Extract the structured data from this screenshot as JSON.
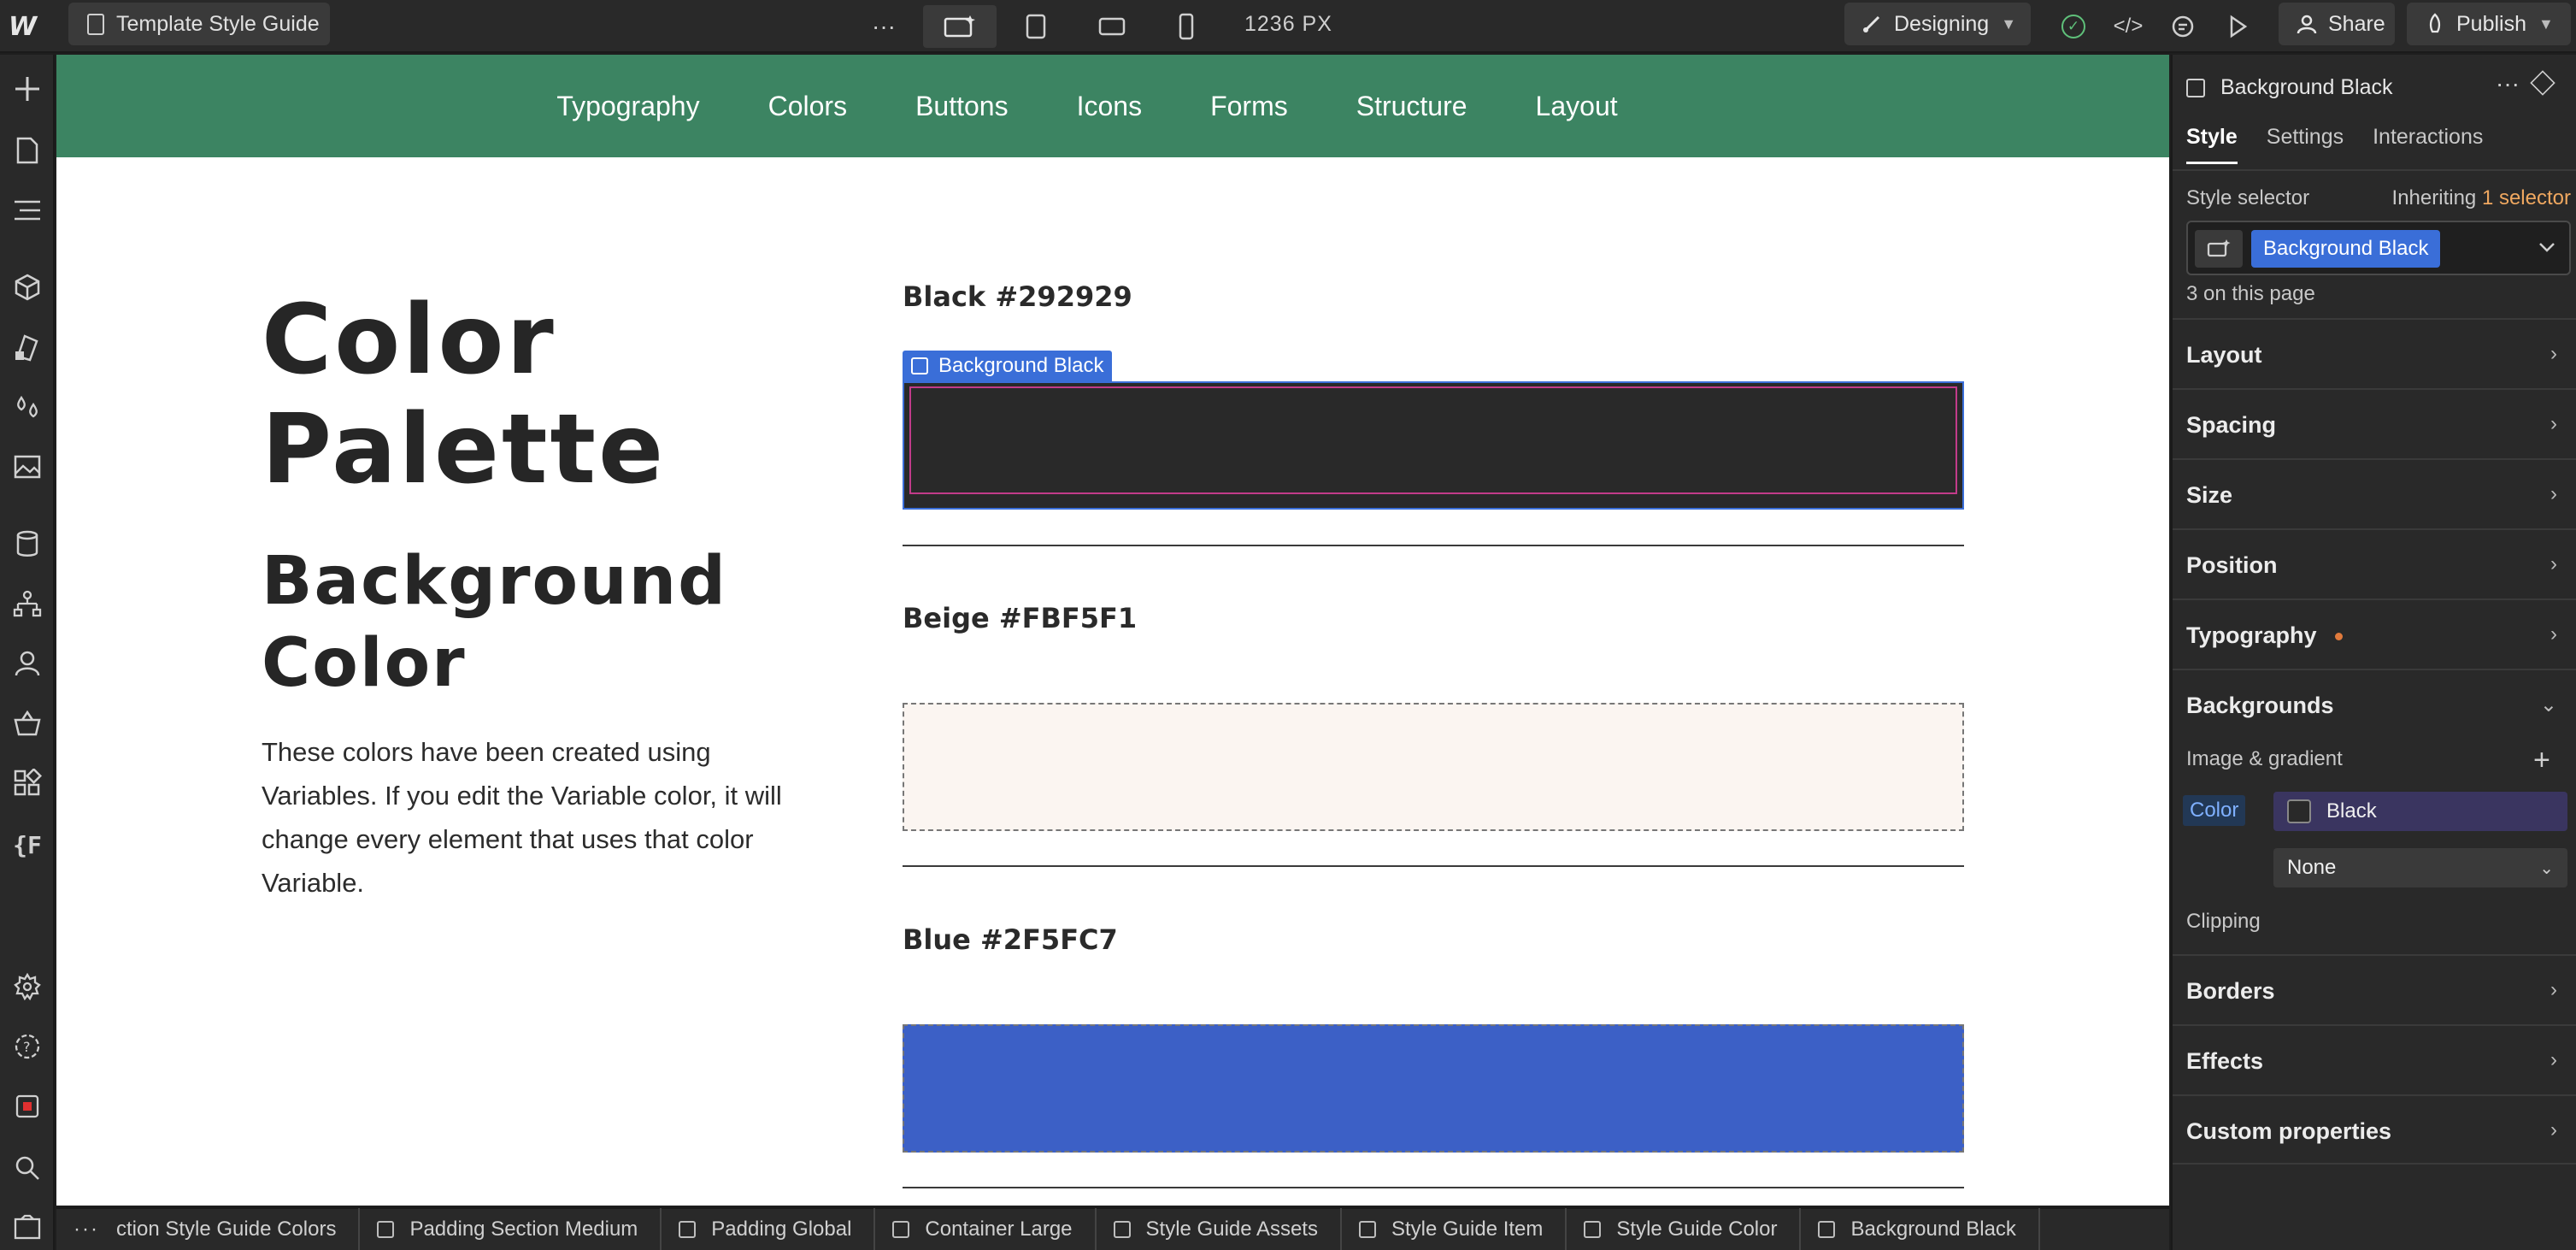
{
  "topbar": {
    "page_name": "Template Style Guide",
    "more": "···",
    "width_readout": "1236 PX",
    "mode": "Designing",
    "share": "Share",
    "publish": "Publish"
  },
  "canvas": {
    "nav": [
      "Typography",
      "Colors",
      "Buttons",
      "Icons",
      "Forms",
      "Structure",
      "Layout"
    ],
    "hero_title_1": "Color",
    "hero_title_2": "Palette",
    "hero_sub_1": "Background",
    "hero_sub_2": "Color",
    "hero_body": "These colors have been created using Variables. If you edit the Variable color, it will change every element that uses that color Variable.",
    "swatches": [
      {
        "label": "Black #292929",
        "color": "#292929"
      },
      {
        "label": "Beige #FBF5F1",
        "color": "#FBF5F1"
      },
      {
        "label": "Blue #2F5FC7",
        "color": "#3c60c6"
      }
    ],
    "selected_tag": "Background Black"
  },
  "breadcrumbs": [
    "ction Style Guide Colors",
    "Padding Section Medium",
    "Padding Global",
    "Container Large",
    "Style Guide Assets",
    "Style Guide Item",
    "Style Guide Color",
    "Background Black"
  ],
  "panel": {
    "element_name": "Background Black",
    "tabs": [
      "Style",
      "Settings",
      "Interactions"
    ],
    "style_selector_label": "Style selector",
    "inheriting_prefix": "Inheriting",
    "inheriting_count": "1 selector",
    "selector_chip": "Background Black",
    "on_page": "3 on this page",
    "sections": [
      "Layout",
      "Spacing",
      "Size",
      "Position",
      "Typography",
      "Backgrounds",
      "Borders",
      "Effects",
      "Custom properties"
    ],
    "image_gradient": "Image & gradient",
    "color_label": "Color",
    "color_value": "Black",
    "clipping_label": "Clipping",
    "clipping_value": "None"
  }
}
